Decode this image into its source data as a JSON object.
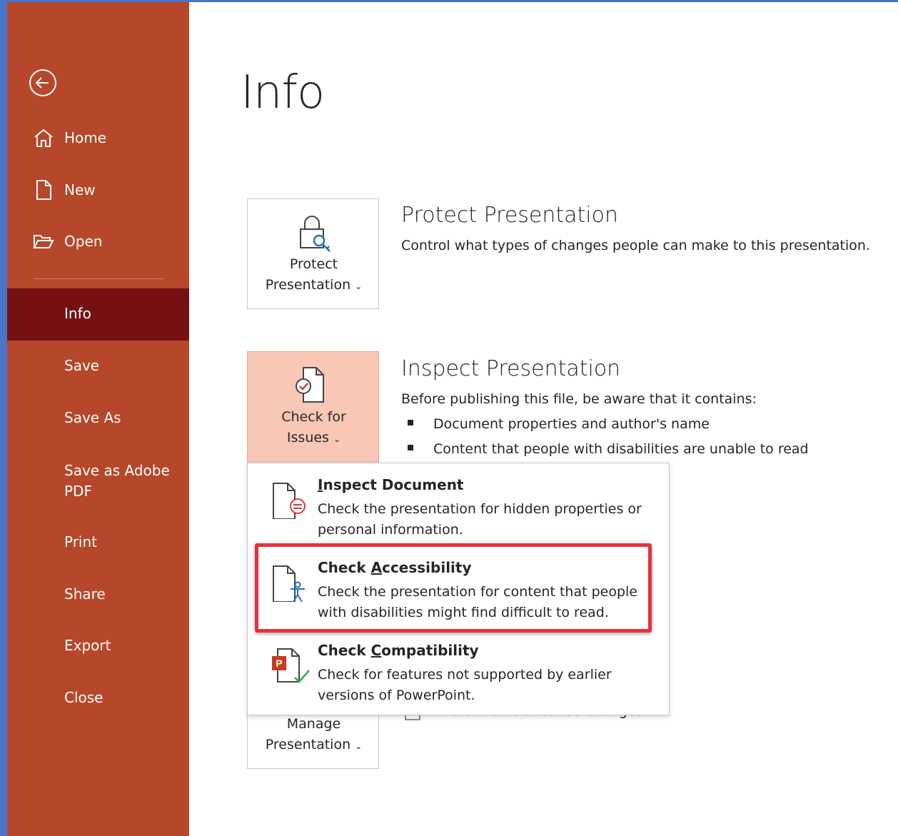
{
  "sidebar": {
    "back_label": "Back",
    "items": [
      {
        "label": "Home",
        "icon": "home-icon"
      },
      {
        "label": "New",
        "icon": "new-document-icon"
      },
      {
        "label": "Open",
        "icon": "open-folder-icon"
      },
      {
        "label": "Info",
        "selected": true
      },
      {
        "label": "Save"
      },
      {
        "label": "Save As"
      },
      {
        "label": "Save as Adobe PDF"
      },
      {
        "label": "Print"
      },
      {
        "label": "Share"
      },
      {
        "label": "Export"
      },
      {
        "label": "Close"
      }
    ]
  },
  "main": {
    "title": "Info",
    "protect": {
      "button_line1": "Protect",
      "button_line2": "Presentation",
      "heading": "Protect Presentation",
      "description": "Control what types of changes people can make to this presentation."
    },
    "inspect": {
      "button_line1": "Check for",
      "button_line2": "Issues",
      "heading": "Inspect Presentation",
      "description": "Before publishing this file, be aware that it contains:",
      "bullets": [
        "Document properties and author's name",
        "Content that people with disabilities are unable to read"
      ]
    },
    "manage": {
      "button_line1": "Manage",
      "button_line2": "Presentation",
      "partial_text": "There are no unsaved changes."
    }
  },
  "dropdown": {
    "items": [
      {
        "title_prefix": "",
        "title_underlined": "I",
        "title_rest": "nspect Document",
        "description": "Check the presentation for hidden properties or personal information."
      },
      {
        "title_prefix": "Check ",
        "title_underlined": "A",
        "title_rest": "ccessibility",
        "description": "Check the presentation for content that people with disabilities might find difficult to read.",
        "highlighted": true
      },
      {
        "title_prefix": "Check ",
        "title_underlined": "C",
        "title_rest": "ompatibility",
        "description": "Check for features not supported by earlier versions of PowerPoint."
      }
    ]
  },
  "colors": {
    "sidebar_bg": "#b7472a",
    "sidebar_selected": "#751113",
    "active_card": "#f8c7b6",
    "highlight_border": "#e8313d"
  }
}
